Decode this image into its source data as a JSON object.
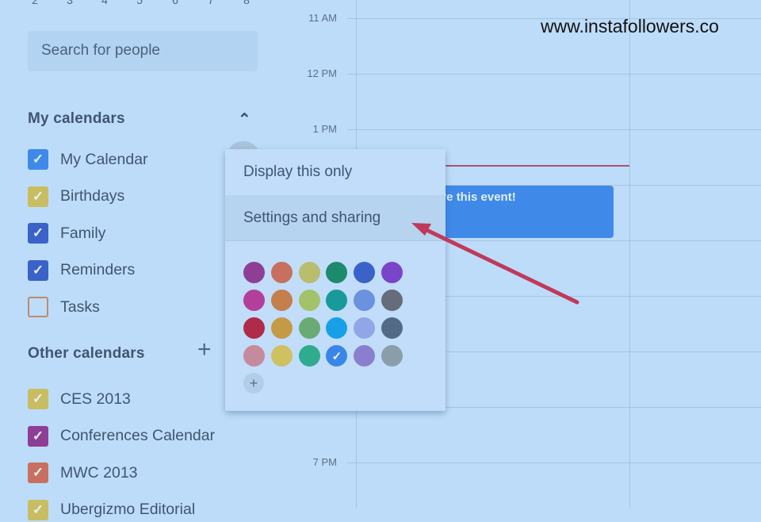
{
  "mini_calendar": {
    "days": [
      "2",
      "3",
      "4",
      "5",
      "6",
      "7",
      "8"
    ]
  },
  "search": {
    "placeholder": "Search for people"
  },
  "my_calendars": {
    "title": "My calendars",
    "collapse_icon": "chevron-up-icon",
    "items": [
      {
        "label": "My Calendar",
        "color": "#3f8ae9",
        "checked": true
      },
      {
        "label": "Birthdays",
        "color": "#c9bd62",
        "checked": true
      },
      {
        "label": "Family",
        "color": "#3a62c9",
        "checked": true
      },
      {
        "label": "Reminders",
        "color": "#3a62c9",
        "checked": true
      },
      {
        "label": "Tasks",
        "color": "#c08a6a",
        "checked": false
      }
    ]
  },
  "other_calendars": {
    "title": "Other calendars",
    "add_icon": "plus-icon",
    "items": [
      {
        "label": "CES 2013",
        "color": "#c9bd62",
        "checked": true
      },
      {
        "label": "Conferences Calendar",
        "color": "#8e3f95",
        "checked": true
      },
      {
        "label": "MWC 2013",
        "color": "#c96f5f",
        "checked": true
      },
      {
        "label": "Ubergizmo Editorial",
        "color": "#c9bd62",
        "checked": true
      }
    ]
  },
  "times": [
    "11 AM",
    "12 PM",
    "1 PM",
    "7 PM"
  ],
  "event": {
    "title": "are this event!",
    "color": "#3f8ae9"
  },
  "menu": {
    "display_only": "Display this only",
    "settings": "Settings and sharing",
    "colors": [
      "#8e3f95",
      "#c96f5f",
      "#b9bd6e",
      "#1b8a6d",
      "#3a62c9",
      "#7b45c9",
      "#b43f9a",
      "#c47f4d",
      "#a3c26b",
      "#199a9a",
      "#6a92de",
      "#666c7a",
      "#b02a4a",
      "#c39a45",
      "#6aaa75",
      "#18a0e6",
      "#90a6e6",
      "#526a85",
      "#c68a9d",
      "#cfc060",
      "#2fab8e",
      "#3a86e8",
      "#8a7fce",
      "#8a9eaa"
    ],
    "selected_color": "#3a86e8",
    "add_color_icon": "plus-icon"
  },
  "annotation": {
    "arrow_color": "#c0395a"
  },
  "watermark": "www.instafollowers.co"
}
